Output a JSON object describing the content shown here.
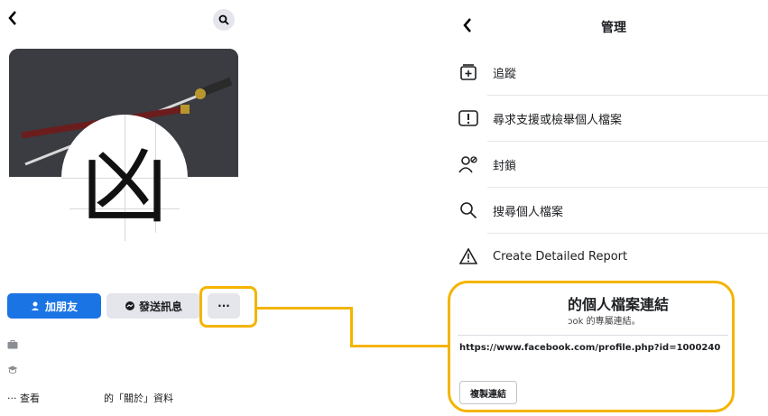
{
  "left_profile": {
    "back_icon": "chevron-left-icon",
    "search_icon": "search-icon",
    "cover": {
      "description_icon": "katana-image"
    },
    "avatar_text": "凶",
    "buttons": {
      "add_friend": "加朋友",
      "message": "發送訊息",
      "more": "···"
    },
    "info_rows": [
      "",
      ""
    ],
    "see_more": "··· 查看",
    "about_text": "的「關於」資料"
  },
  "right_panel": {
    "back_icon": "chevron-left-icon",
    "title": "管理",
    "menu": [
      {
        "icon": "follow-icon",
        "label": "追蹤"
      },
      {
        "icon": "report-icon",
        "label": "尋求支援或檢舉個人檔案"
      },
      {
        "icon": "block-icon",
        "label": "封鎖"
      },
      {
        "icon": "search-icon",
        "label": "搜尋個人檔案"
      },
      {
        "icon": "warning-icon",
        "label": "Create Detailed Report"
      }
    ],
    "dialog": {
      "title": "的個人檔案連結",
      "subtitle": "ɔok 的專屬連結。",
      "url": "https://www.facebook.com/profile.php?id=1000240",
      "copy_button": "複製連結"
    }
  },
  "colors": {
    "accent": "#1b74e4",
    "highlight": "#f4b400"
  }
}
